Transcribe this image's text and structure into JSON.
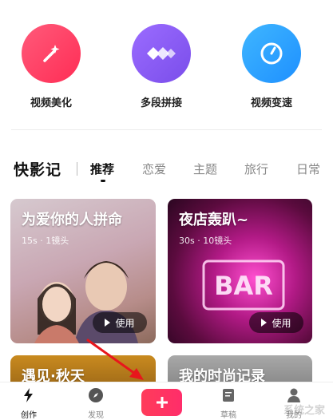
{
  "tools": [
    {
      "label": "视频美化",
      "icon": "magic-wand-icon",
      "color": "#ff3f66"
    },
    {
      "label": "多段拼接",
      "icon": "segments-icon",
      "color": "#8b5cf6"
    },
    {
      "label": "视频变速",
      "icon": "speedometer-icon",
      "color": "#2ea8ff"
    }
  ],
  "brand": "快影记",
  "tabs": [
    "推荐",
    "恋爱",
    "主题",
    "旅行",
    "日常"
  ],
  "cards": [
    {
      "title": "为爱你的人拼命",
      "meta": "15s · 1镜头",
      "use": "使用"
    },
    {
      "title": "夜店轰趴~",
      "meta": "30s · 10镜头",
      "use": "使用"
    },
    {
      "title": "遇见·秋天"
    },
    {
      "title": "我的时尚记录"
    }
  ],
  "nav": [
    {
      "label": "创作",
      "icon": "lightning-icon"
    },
    {
      "label": "发现",
      "icon": "compass-icon"
    },
    {
      "label": "",
      "icon": "plus-icon"
    },
    {
      "label": "草稿",
      "icon": "drafts-icon"
    },
    {
      "label": "我的",
      "icon": "profile-icon"
    }
  ],
  "watermark": "系统之家",
  "colors": {
    "accent": "#ff2d55",
    "arrow": "#e8161c"
  }
}
